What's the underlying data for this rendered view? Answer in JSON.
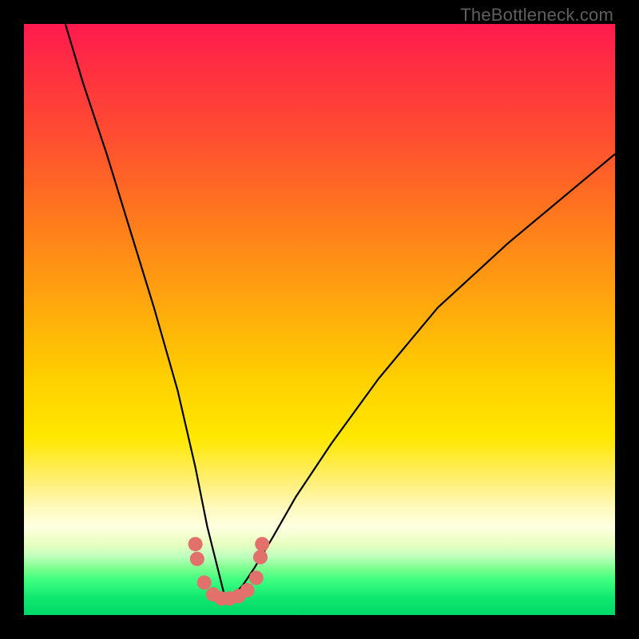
{
  "watermark": "TheBottleneck.com",
  "colors": {
    "background": "#000000",
    "curve": "#000000",
    "marker": "#e2706b"
  },
  "chart_data": {
    "type": "line",
    "title": "",
    "xlabel": "",
    "ylabel": "",
    "xlim": [
      0,
      100
    ],
    "ylim": [
      0,
      100
    ],
    "grid": false,
    "legend": false,
    "note": "Axes are unlabeled; values are estimated proportions of the plot area (0–100). Curve depicts a V-shaped bottleneck profile with minimum near x≈34.",
    "series": [
      {
        "name": "bottleneck-curve",
        "x": [
          7,
          10,
          14,
          18,
          22,
          26,
          29,
          31,
          33,
          34,
          35,
          37,
          39,
          42,
          46,
          52,
          60,
          70,
          82,
          94,
          100
        ],
        "values": [
          100,
          90,
          78,
          65,
          52,
          38,
          25,
          15,
          7,
          3,
          3,
          5,
          8,
          13,
          20,
          29,
          40,
          52,
          63,
          73,
          78
        ]
      }
    ],
    "markers": [
      {
        "x": 29.0,
        "y": 12.0
      },
      {
        "x": 29.3,
        "y": 9.5
      },
      {
        "x": 30.5,
        "y": 5.5
      },
      {
        "x": 32.0,
        "y": 3.5
      },
      {
        "x": 33.4,
        "y": 2.8
      },
      {
        "x": 34.8,
        "y": 2.8
      },
      {
        "x": 36.3,
        "y": 3.2
      },
      {
        "x": 37.8,
        "y": 4.2
      },
      {
        "x": 39.3,
        "y": 6.3
      },
      {
        "x": 40.0,
        "y": 9.8
      },
      {
        "x": 40.3,
        "y": 12.0
      }
    ]
  }
}
